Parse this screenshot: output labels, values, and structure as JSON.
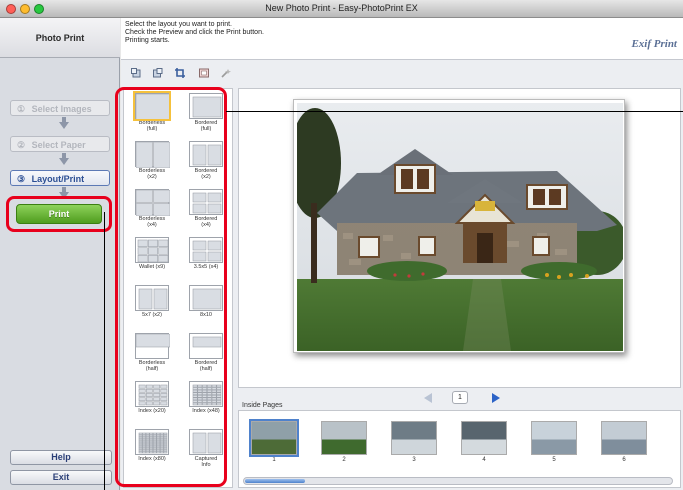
{
  "window": {
    "title": "New Photo Print - Easy-PhotoPrint EX"
  },
  "sidebar": {
    "header": "Photo Print",
    "steps": [
      {
        "num": "①",
        "label": "Select Images"
      },
      {
        "num": "②",
        "label": "Select Paper"
      },
      {
        "num": "③",
        "label": "Layout/Print"
      }
    ],
    "print_label": "Print",
    "help_label": "Help",
    "exit_label": "Exit"
  },
  "instructions": {
    "line1": "Select the layout you want to print.",
    "line2": "Check the Preview and click the Print button.",
    "line3": "Printing starts.",
    "logo": "Exif Print"
  },
  "layouts": [
    {
      "label1": "Borderless",
      "label2": "(full)",
      "grid": "1x1",
      "selected": true
    },
    {
      "label1": "Bordered",
      "label2": "(full)",
      "grid": "1x1b"
    },
    {
      "label1": "Borderless",
      "label2": "(x2)",
      "grid": "2v"
    },
    {
      "label1": "Bordered",
      "label2": "(x2)",
      "grid": "2vb"
    },
    {
      "label1": "Borderless",
      "label2": "(x4)",
      "grid": "4"
    },
    {
      "label1": "Bordered",
      "label2": "(x4)",
      "grid": "4b"
    },
    {
      "label1": "Wallet (x9)",
      "label2": "",
      "grid": "9"
    },
    {
      "label1": "3.5x5 (x4)",
      "label2": "",
      "grid": "4b"
    },
    {
      "label1": "5x7 (x2)",
      "label2": "",
      "grid": "2vb"
    },
    {
      "label1": "8x10",
      "label2": "",
      "grid": "1x1b"
    },
    {
      "label1": "Borderless",
      "label2": "(half)",
      "grid": "half"
    },
    {
      "label1": "Bordered",
      "label2": "(half)",
      "grid": "halfb"
    },
    {
      "label1": "Index (x20)",
      "label2": "",
      "grid": "20"
    },
    {
      "label1": "Index (x48)",
      "label2": "",
      "grid": "48"
    },
    {
      "label1": "Index (x80)",
      "label2": "",
      "grid": "80"
    },
    {
      "label1": "Captured",
      "label2": "Info",
      "grid": "cap"
    }
  ],
  "pager": {
    "page": "1"
  },
  "inside_pages": {
    "label": "Inside Pages",
    "thumbs": [
      "1",
      "2",
      "3",
      "4",
      "5",
      "6"
    ]
  },
  "colors": {
    "highlight": "#e8001c",
    "print_green": "#4f9d1e",
    "accent_blue": "#2c4f94"
  }
}
